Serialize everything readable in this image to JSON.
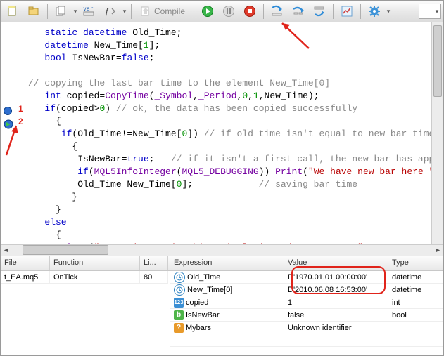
{
  "toolbar": {
    "compile_label": "Compile"
  },
  "code": {
    "lines_html": "   <span class='c-keyword'>static</span> <span class='c-type'>datetime</span> Old_Time;\n   <span class='c-type'>datetime</span> New_Time[<span class='c-num'>1</span>];\n   <span class='c-type'>bool</span> IsNewBar=<span class='c-keyword'>false</span>;\n\n<span class='c-comment'>// copying the last bar time to the element New_Time[0]</span>\n   <span class='c-type'>int</span> copied=<span class='c-func'>CopyTime</span>(<span class='c-const'>_Symbol</span>,<span class='c-const'>_Period</span>,<span class='c-num'>0</span>,<span class='c-num'>1</span>,New_Time);\n   <span class='c-keyword'>if</span>(copied&gt;<span class='c-num'>0</span>) <span class='c-comment'>// ok, the data has been copied successfully</span>\n     {\n      <span class='c-keyword'>if</span>(Old_Time!=New_Time[<span class='c-num'>0</span>]) <span class='c-comment'>// if old time isn't equal to new bar time</span>\n        {\n         IsNewBar=<span class='c-keyword'>true</span>;   <span class='c-comment'>// if it isn't a first call, the new bar has app</span>\n         <span class='c-keyword'>if</span>(<span class='c-func'>MQL5InfoInteger</span>(<span class='c-const'>MQL5_DEBUGGING</span>)) <span class='c-func'>Print</span>(<span class='c-string'>&quot;We have new bar here &quot;</span>\n         Old_Time=New_Time[<span class='c-num'>0</span>];            <span class='c-comment'>// saving bar time</span>\n        }\n     }\n   <span class='c-keyword'>else</span>\n     {\n      <span class='c-func'>Alert</span>(<span class='c-string'>&quot;Error in copying historical times data, error =&quot;</span> <span class='c-func'>GetLastErro</span>"
  },
  "breakpoints": {
    "bp1_num": "1",
    "bp2_num": "2"
  },
  "left_pane": {
    "headers": {
      "file": "File",
      "function": "Function",
      "line": "Li..."
    },
    "rows": [
      {
        "file": "t_EA.mq5",
        "function": "OnTick",
        "line": "80"
      }
    ]
  },
  "right_pane": {
    "headers": {
      "expression": "Expression",
      "value": "Value",
      "type": "Type"
    },
    "rows": [
      {
        "icon": "clock",
        "expr": "Old_Time",
        "value": "D'1970.01.01 00:00:00'",
        "type": "datetime"
      },
      {
        "icon": "clock",
        "expr": "New_Time[0]",
        "value": "D'2010.06.08 16:53:00'",
        "type": "datetime"
      },
      {
        "icon": "int",
        "expr": "copied",
        "value": "1",
        "type": "int"
      },
      {
        "icon": "bool",
        "expr": "IsNewBar",
        "value": "false",
        "type": "bool"
      },
      {
        "icon": "unknown",
        "expr": "Mybars",
        "value": "Unknown identifier",
        "type": ""
      }
    ]
  }
}
